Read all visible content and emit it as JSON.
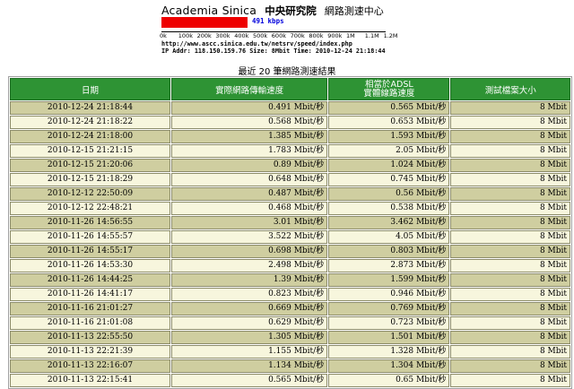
{
  "header": {
    "title_en": "Academia Sinica",
    "title_zh": "中央研究院",
    "title_sub": "網路測速中心",
    "speed_value": "491",
    "speed_unit": "kbps",
    "speed_fraction_of_scale": 0.384,
    "scale_ticks": [
      "0k",
      "100k",
      "200k",
      "300k",
      "400k",
      "500k",
      "600k",
      "700k",
      "800k",
      "900k",
      "1M",
      "1.1M",
      "1.2M"
    ],
    "url_line": "http://www.ascc.sinica.edu.tw/netsrv/speed/index.php",
    "ip_line": "IP Addr: 118.150.159.76 Size: 8Mbit Time: 2010-12-24 21:18:44",
    "bar_color": "#ee0000",
    "label_color": "#0000dd"
  },
  "caption": "最近 20 筆網路測速結果",
  "table": {
    "header_color": "#2e9334",
    "row_color_a": "#cfcea0",
    "row_color_b": "#f7f6dd",
    "columns": {
      "date": "日期",
      "actual": "實際網路傳輸速度",
      "adsl_line1": "相當於ADSL",
      "adsl_line2": "實體線路速度",
      "size": "測試檔案大小"
    },
    "rows": [
      {
        "date": "2010-12-24 21:18:44",
        "actual": "0.491 Mbit/秒",
        "adsl": "0.565 Mbit/秒",
        "size": "8 Mbit"
      },
      {
        "date": "2010-12-24 21:18:22",
        "actual": "0.568 Mbit/秒",
        "adsl": "0.653 Mbit/秒",
        "size": "8 Mbit"
      },
      {
        "date": "2010-12-24 21:18:00",
        "actual": "1.385 Mbit/秒",
        "adsl": "1.593 Mbit/秒",
        "size": "8 Mbit"
      },
      {
        "date": "2010-12-15 21:21:15",
        "actual": "1.783 Mbit/秒",
        "adsl": "2.05 Mbit/秒",
        "size": "8 Mbit"
      },
      {
        "date": "2010-12-15 21:20:06",
        "actual": "0.89 Mbit/秒",
        "adsl": "1.024 Mbit/秒",
        "size": "8 Mbit"
      },
      {
        "date": "2010-12-15 21:18:29",
        "actual": "0.648 Mbit/秒",
        "adsl": "0.745 Mbit/秒",
        "size": "8 Mbit"
      },
      {
        "date": "2010-12-12 22:50:09",
        "actual": "0.487 Mbit/秒",
        "adsl": "0.56 Mbit/秒",
        "size": "8 Mbit"
      },
      {
        "date": "2010-12-12 22:48:21",
        "actual": "0.468 Mbit/秒",
        "adsl": "0.538 Mbit/秒",
        "size": "8 Mbit"
      },
      {
        "date": "2010-11-26 14:56:55",
        "actual": "3.01 Mbit/秒",
        "adsl": "3.462 Mbit/秒",
        "size": "8 Mbit"
      },
      {
        "date": "2010-11-26 14:55:57",
        "actual": "3.522 Mbit/秒",
        "adsl": "4.05 Mbit/秒",
        "size": "8 Mbit"
      },
      {
        "date": "2010-11-26 14:55:17",
        "actual": "0.698 Mbit/秒",
        "adsl": "0.803 Mbit/秒",
        "size": "8 Mbit"
      },
      {
        "date": "2010-11-26 14:53:30",
        "actual": "2.498 Mbit/秒",
        "adsl": "2.873 Mbit/秒",
        "size": "8 Mbit"
      },
      {
        "date": "2010-11-26 14:44:25",
        "actual": "1.39 Mbit/秒",
        "adsl": "1.599 Mbit/秒",
        "size": "8 Mbit"
      },
      {
        "date": "2010-11-26 14:41:17",
        "actual": "0.823 Mbit/秒",
        "adsl": "0.946 Mbit/秒",
        "size": "8 Mbit"
      },
      {
        "date": "2010-11-16 21:01:27",
        "actual": "0.669 Mbit/秒",
        "adsl": "0.769 Mbit/秒",
        "size": "8 Mbit"
      },
      {
        "date": "2010-11-16 21:01:08",
        "actual": "0.629 Mbit/秒",
        "adsl": "0.723 Mbit/秒",
        "size": "8 Mbit"
      },
      {
        "date": "2010-11-13 22:55:50",
        "actual": "1.305 Mbit/秒",
        "adsl": "1.501 Mbit/秒",
        "size": "8 Mbit"
      },
      {
        "date": "2010-11-13 22:21:39",
        "actual": "1.155 Mbit/秒",
        "adsl": "1.328 Mbit/秒",
        "size": "8 Mbit"
      },
      {
        "date": "2010-11-13 22:16:07",
        "actual": "1.134 Mbit/秒",
        "adsl": "1.304 Mbit/秒",
        "size": "8 Mbit"
      },
      {
        "date": "2010-11-13 22:15:41",
        "actual": "0.565 Mbit/秒",
        "adsl": "0.65 Mbit/秒",
        "size": "8 Mbit"
      }
    ]
  }
}
